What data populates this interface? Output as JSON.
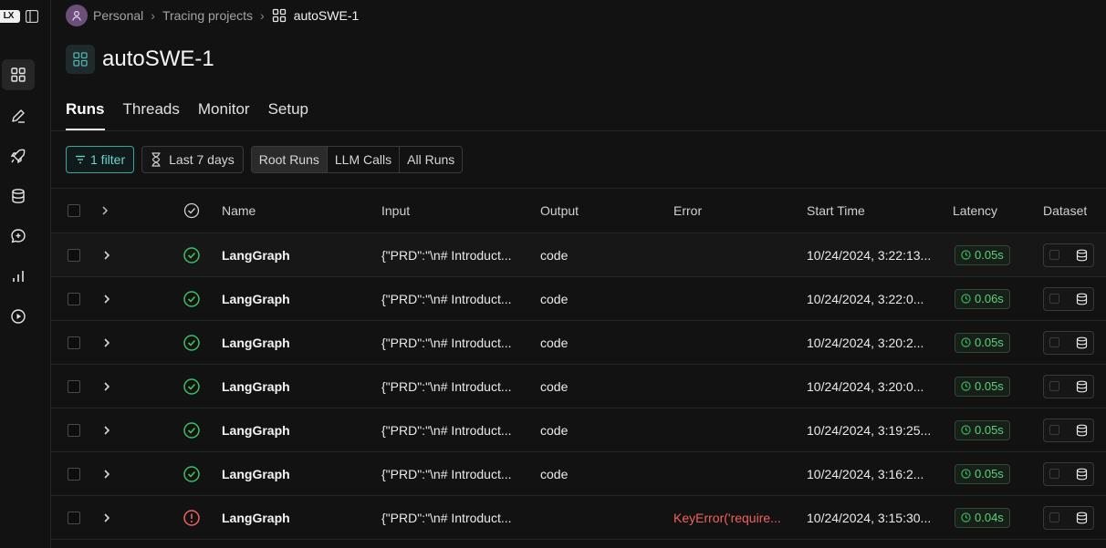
{
  "breadcrumb": {
    "workspace": "Personal",
    "section": "Tracing projects",
    "project": "autoSWE-1"
  },
  "page": {
    "title": "autoSWE-1"
  },
  "tabs": [
    "Runs",
    "Threads",
    "Monitor",
    "Setup"
  ],
  "active_tab": "Runs",
  "toolbar": {
    "filter_label": "1 filter",
    "date_label": "Last 7 days",
    "run_types": [
      "Root Runs",
      "LLM Calls",
      "All Runs"
    ],
    "active_run_type": "Root Runs"
  },
  "table": {
    "columns": {
      "name": "Name",
      "input": "Input",
      "output": "Output",
      "error": "Error",
      "start_time": "Start Time",
      "latency": "Latency",
      "dataset": "Dataset"
    },
    "rows": [
      {
        "status": "success",
        "name": "LangGraph",
        "input": "{\"PRD\":\"\\n# Introduct...",
        "output": "code",
        "error": "",
        "start_time": "10/24/2024, 3:22:13...",
        "latency": "0.05s"
      },
      {
        "status": "success",
        "name": "LangGraph",
        "input": "{\"PRD\":\"\\n# Introduct...",
        "output": "code",
        "error": "",
        "start_time": "10/24/2024, 3:22:0...",
        "latency": "0.06s"
      },
      {
        "status": "success",
        "name": "LangGraph",
        "input": "{\"PRD\":\"\\n# Introduct...",
        "output": "code",
        "error": "",
        "start_time": "10/24/2024, 3:20:2...",
        "latency": "0.05s"
      },
      {
        "status": "success",
        "name": "LangGraph",
        "input": "{\"PRD\":\"\\n# Introduct...",
        "output": "code",
        "error": "",
        "start_time": "10/24/2024, 3:20:0...",
        "latency": "0.05s"
      },
      {
        "status": "success",
        "name": "LangGraph",
        "input": "{\"PRD\":\"\\n# Introduct...",
        "output": "code",
        "error": "",
        "start_time": "10/24/2024, 3:19:25...",
        "latency": "0.05s"
      },
      {
        "status": "success",
        "name": "LangGraph",
        "input": "{\"PRD\":\"\\n# Introduct...",
        "output": "code",
        "error": "",
        "start_time": "10/24/2024, 3:16:2...",
        "latency": "0.05s"
      },
      {
        "status": "error",
        "name": "LangGraph",
        "input": "{\"PRD\":\"\\n# Introduct...",
        "output": "",
        "error": "KeyError('require...",
        "start_time": "10/24/2024, 3:15:30...",
        "latency": "0.04s"
      }
    ]
  },
  "colors": {
    "accent": "#3aa6a0",
    "success": "#3fbf5f",
    "error": "#f0625f"
  },
  "icons": {
    "rail": [
      "projects-icon",
      "annotate-icon",
      "deploy-rocket-icon",
      "datasets-icon",
      "prompts-chat-icon",
      "monitoring-chart-icon",
      "playground-play-icon"
    ]
  }
}
